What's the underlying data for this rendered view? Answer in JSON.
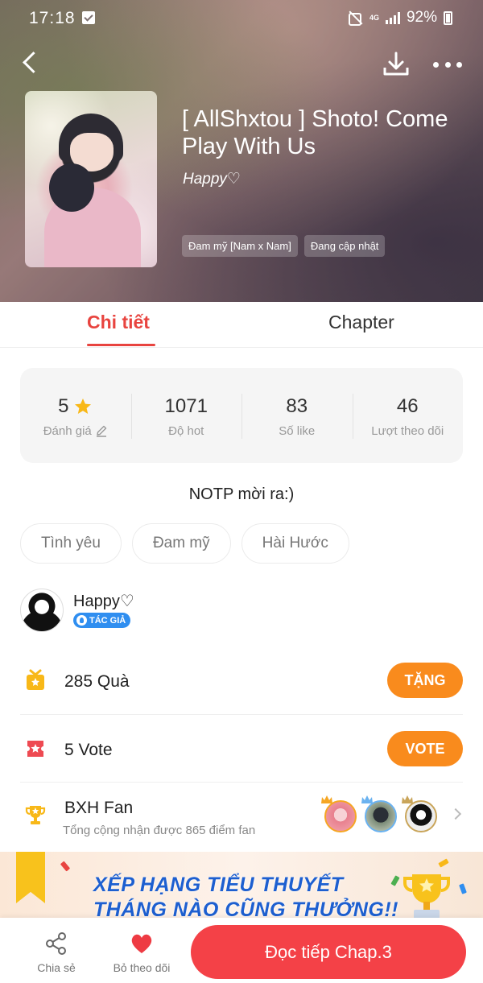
{
  "status_bar": {
    "time": "17:18",
    "network": "4G",
    "battery": "92%"
  },
  "story": {
    "title": "[ AllShxtou ] Shoto! Come Play With Us",
    "author": "Happy♡",
    "tags": [
      "Đam mỹ [Nam x Nam]",
      "Đang cập nhật"
    ]
  },
  "tabs": {
    "detail": "Chi tiết",
    "chapter": "Chapter"
  },
  "stats": {
    "rating_value": "5",
    "rating_label": "Đánh giá",
    "hot_value": "1071",
    "hot_label": "Độ hot",
    "like_value": "83",
    "like_label": "Số like",
    "follow_value": "46",
    "follow_label": "Lượt theo dõi"
  },
  "description": "NOTP mời ra:)",
  "genres": [
    "Tình yêu",
    "Đam mỹ",
    "Hài Hước"
  ],
  "author_section": {
    "name": "Happy♡",
    "badge": "TÁC GIẢ"
  },
  "gift": {
    "text": "285 Quà",
    "button": "TẶNG"
  },
  "vote": {
    "text": "5 Vote",
    "button": "VOTE"
  },
  "fan_ranking": {
    "title": "BXH Fan",
    "subtitle": "Tổng cộng nhận được 865 điểm fan"
  },
  "banner": {
    "line1": "XẾP HẠNG TIỂU THUYẾT",
    "line2": "THÁNG NÀO CŨNG THƯỞNG!!"
  },
  "bottom_bar": {
    "share": "Chia sẻ",
    "unfollow": "Bỏ theo dõi",
    "read": "Đọc tiếp Chap.3"
  },
  "colors": {
    "accent_red": "#e8443f",
    "orange_button": "#f98b1d",
    "read_button": "#f44147",
    "badge_blue": "#2f8ef0"
  },
  "icons": {
    "back": "chevron-left-icon",
    "download": "download-icon",
    "more": "more-dots-icon",
    "rating": "star-icon",
    "edit": "pencil-icon",
    "gift": "gift-icon",
    "vote": "ticket-icon",
    "fan": "trophy-icon",
    "share": "share-icon",
    "unfollow": "heart-icon"
  }
}
